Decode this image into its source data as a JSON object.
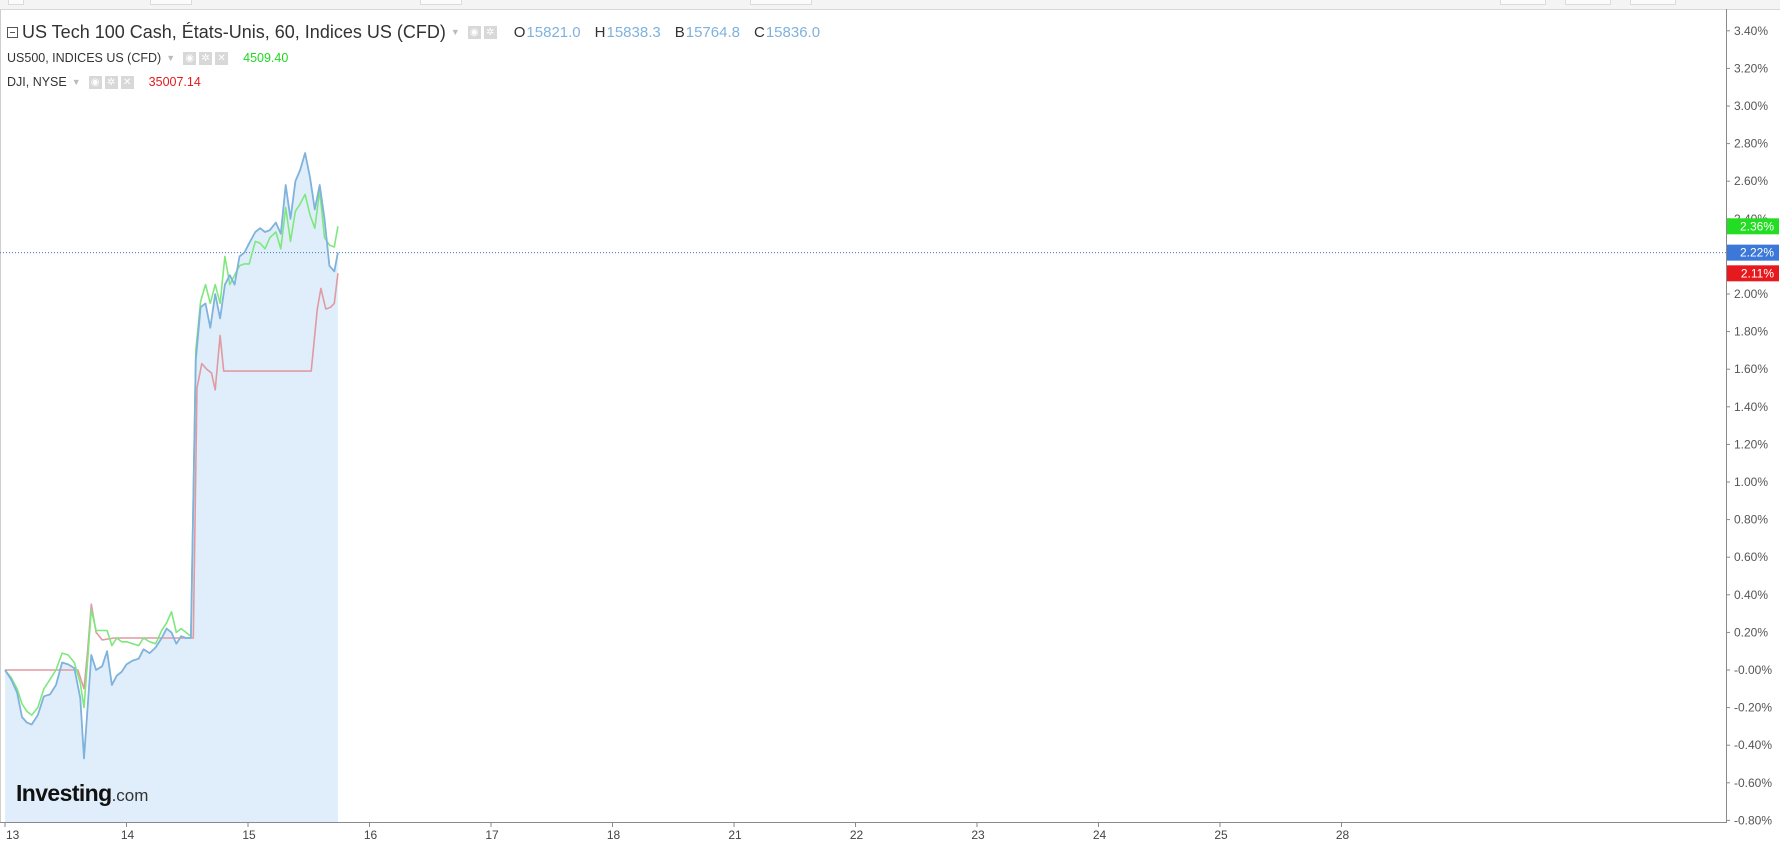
{
  "legend": {
    "main": {
      "name": "US Tech 100 Cash, États-Unis, 60, Indices US (CFD)",
      "ohlc": [
        {
          "label": "O",
          "value": "15821.0"
        },
        {
          "label": "H",
          "value": "15838.3"
        },
        {
          "label": "B",
          "value": "15764.8"
        },
        {
          "label": "C",
          "value": "15836.0"
        }
      ]
    },
    "compare": [
      {
        "name": "US500, INDICES US (CFD)",
        "value": "4509.40",
        "color": "#1fd81f"
      },
      {
        "name": "DJI, NYSE",
        "value": "35007.14",
        "color": "#e6191e"
      }
    ]
  },
  "logo": {
    "main": "Investing",
    "suffix": ".com"
  },
  "colors": {
    "main_line": "#7fb2dc",
    "main_fill": "#dfeefa",
    "green": "#7ee87e",
    "red": "#e09aa1"
  },
  "chart_data": {
    "type": "line",
    "ylabel": "",
    "y_unit": "%",
    "ylim": [
      -0.8,
      3.5
    ],
    "y_ticks": [
      "3.40%",
      "3.20%",
      "3.00%",
      "2.80%",
      "2.60%",
      "2.40%",
      "2.20%",
      "2.00%",
      "1.80%",
      "1.60%",
      "1.40%",
      "1.20%",
      "1.00%",
      "0.80%",
      "0.60%",
      "0.40%",
      "0.20%",
      "-0.00%",
      "-0.20%",
      "-0.40%",
      "-0.60%",
      "-0.80%"
    ],
    "x_ticks": [
      {
        "label": "13",
        "x": 0
      },
      {
        "label": "14",
        "x": 1
      },
      {
        "label": "15",
        "x": 2
      },
      {
        "label": "16",
        "x": 3
      },
      {
        "label": "17",
        "x": 4
      },
      {
        "label": "18",
        "x": 5
      },
      {
        "label": "21",
        "x": 6
      },
      {
        "label": "22",
        "x": 7
      },
      {
        "label": "23",
        "x": 8
      },
      {
        "label": "24",
        "x": 9
      },
      {
        "label": "25",
        "x": 10
      },
      {
        "label": "28",
        "x": 11
      }
    ],
    "x_range": [
      0,
      12.5
    ],
    "price_line": 2.22,
    "series": [
      {
        "name": "US Tech 100 Cash",
        "last_label": "2.22%",
        "label_color": "#3b78d8",
        "points": [
          [
            0,
            0
          ],
          [
            0.05,
            -0.05
          ],
          [
            0.1,
            -0.12
          ],
          [
            0.14,
            -0.25
          ],
          [
            0.18,
            -0.28
          ],
          [
            0.22,
            -0.29
          ],
          [
            0.27,
            -0.24
          ],
          [
            0.32,
            -0.14
          ],
          [
            0.37,
            -0.13
          ],
          [
            0.42,
            -0.08
          ],
          [
            0.47,
            0.04
          ],
          [
            0.52,
            0.03
          ],
          [
            0.57,
            0.01
          ],
          [
            0.62,
            -0.15
          ],
          [
            0.65,
            -0.47
          ],
          [
            0.68,
            -0.2
          ],
          [
            0.71,
            0.08
          ],
          [
            0.75,
            0
          ],
          [
            0.8,
            0.02
          ],
          [
            0.84,
            0.1
          ],
          [
            0.88,
            -0.08
          ],
          [
            0.92,
            -0.03
          ],
          [
            0.96,
            -0.01
          ],
          [
            1.0,
            0.03
          ],
          [
            1.05,
            0.05
          ],
          [
            1.1,
            0.06
          ],
          [
            1.14,
            0.11
          ],
          [
            1.19,
            0.09
          ],
          [
            1.24,
            0.12
          ],
          [
            1.29,
            0.17
          ],
          [
            1.33,
            0.22
          ],
          [
            1.37,
            0.2
          ],
          [
            1.41,
            0.14
          ],
          [
            1.45,
            0.18
          ],
          [
            1.49,
            0.17
          ],
          [
            1.53,
            0.17
          ],
          [
            1.57,
            1.65
          ],
          [
            1.61,
            1.93
          ],
          [
            1.65,
            1.95
          ],
          [
            1.69,
            1.82
          ],
          [
            1.73,
            2.0
          ],
          [
            1.77,
            1.87
          ],
          [
            1.81,
            2.05
          ],
          [
            1.85,
            2.1
          ],
          [
            1.89,
            2.05
          ],
          [
            1.93,
            2.2
          ],
          [
            1.97,
            2.22
          ],
          [
            2.01,
            2.27
          ],
          [
            2.06,
            2.33
          ],
          [
            2.1,
            2.35
          ],
          [
            2.14,
            2.33
          ],
          [
            2.18,
            2.34
          ],
          [
            2.23,
            2.38
          ],
          [
            2.27,
            2.32
          ],
          [
            2.31,
            2.58
          ],
          [
            2.35,
            2.4
          ],
          [
            2.39,
            2.6
          ],
          [
            2.43,
            2.66
          ],
          [
            2.47,
            2.75
          ],
          [
            2.51,
            2.62
          ],
          [
            2.55,
            2.45
          ],
          [
            2.59,
            2.58
          ],
          [
            2.63,
            2.4
          ],
          [
            2.67,
            2.15
          ],
          [
            2.71,
            2.12
          ],
          [
            2.74,
            2.22
          ]
        ]
      },
      {
        "name": "US500",
        "last_label": "2.36%",
        "label_color": "#22dd22",
        "points": [
          [
            0,
            0
          ],
          [
            0.05,
            -0.04
          ],
          [
            0.1,
            -0.1
          ],
          [
            0.14,
            -0.18
          ],
          [
            0.18,
            -0.22
          ],
          [
            0.22,
            -0.24
          ],
          [
            0.27,
            -0.2
          ],
          [
            0.32,
            -0.1
          ],
          [
            0.37,
            -0.05
          ],
          [
            0.42,
            0
          ],
          [
            0.47,
            0.09
          ],
          [
            0.52,
            0.08
          ],
          [
            0.57,
            0.04
          ],
          [
            0.62,
            -0.07
          ],
          [
            0.65,
            -0.2
          ],
          [
            0.68,
            0.05
          ],
          [
            0.71,
            0.32
          ],
          [
            0.75,
            0.21
          ],
          [
            0.8,
            0.21
          ],
          [
            0.84,
            0.21
          ],
          [
            0.88,
            0.13
          ],
          [
            0.92,
            0.17
          ],
          [
            0.96,
            0.15
          ],
          [
            1.0,
            0.15
          ],
          [
            1.05,
            0.14
          ],
          [
            1.1,
            0.13
          ],
          [
            1.14,
            0.17
          ],
          [
            1.19,
            0.15
          ],
          [
            1.24,
            0.14
          ],
          [
            1.29,
            0.21
          ],
          [
            1.33,
            0.25
          ],
          [
            1.37,
            0.31
          ],
          [
            1.41,
            0.2
          ],
          [
            1.45,
            0.22
          ],
          [
            1.49,
            0.2
          ],
          [
            1.53,
            0.18
          ],
          [
            1.57,
            1.7
          ],
          [
            1.61,
            1.96
          ],
          [
            1.65,
            2.05
          ],
          [
            1.69,
            1.95
          ],
          [
            1.73,
            2.05
          ],
          [
            1.77,
            1.95
          ],
          [
            1.81,
            2.2
          ],
          [
            1.85,
            2.05
          ],
          [
            1.89,
            2.1
          ],
          [
            1.93,
            2.15
          ],
          [
            1.97,
            2.16
          ],
          [
            2.01,
            2.16
          ],
          [
            2.06,
            2.28
          ],
          [
            2.1,
            2.27
          ],
          [
            2.14,
            2.24
          ],
          [
            2.18,
            2.3
          ],
          [
            2.23,
            2.33
          ],
          [
            2.27,
            2.24
          ],
          [
            2.31,
            2.46
          ],
          [
            2.35,
            2.28
          ],
          [
            2.39,
            2.44
          ],
          [
            2.43,
            2.48
          ],
          [
            2.47,
            2.53
          ],
          [
            2.51,
            2.42
          ],
          [
            2.55,
            2.35
          ],
          [
            2.59,
            2.55
          ],
          [
            2.63,
            2.3
          ],
          [
            2.67,
            2.26
          ],
          [
            2.71,
            2.25
          ],
          [
            2.74,
            2.36
          ]
        ]
      },
      {
        "name": "DJI",
        "last_label": "2.11%",
        "label_color": "#e6191e",
        "points": [
          [
            0,
            0
          ],
          [
            0.55,
            0
          ],
          [
            0.6,
            0
          ],
          [
            0.65,
            -0.1
          ],
          [
            0.68,
            0.1
          ],
          [
            0.71,
            0.35
          ],
          [
            0.75,
            0.2
          ],
          [
            0.8,
            0.16
          ],
          [
            0.9,
            0.17
          ],
          [
            1.55,
            0.17
          ],
          [
            1.58,
            1.5
          ],
          [
            1.62,
            1.63
          ],
          [
            1.66,
            1.6
          ],
          [
            1.7,
            1.58
          ],
          [
            1.73,
            1.49
          ],
          [
            1.77,
            1.78
          ],
          [
            1.8,
            1.59
          ],
          [
            2.45,
            1.59
          ],
          [
            2.52,
            1.59
          ],
          [
            2.57,
            1.92
          ],
          [
            2.6,
            2.03
          ],
          [
            2.64,
            1.92
          ],
          [
            2.68,
            1.93
          ],
          [
            2.71,
            1.95
          ],
          [
            2.74,
            2.11
          ]
        ]
      }
    ]
  }
}
